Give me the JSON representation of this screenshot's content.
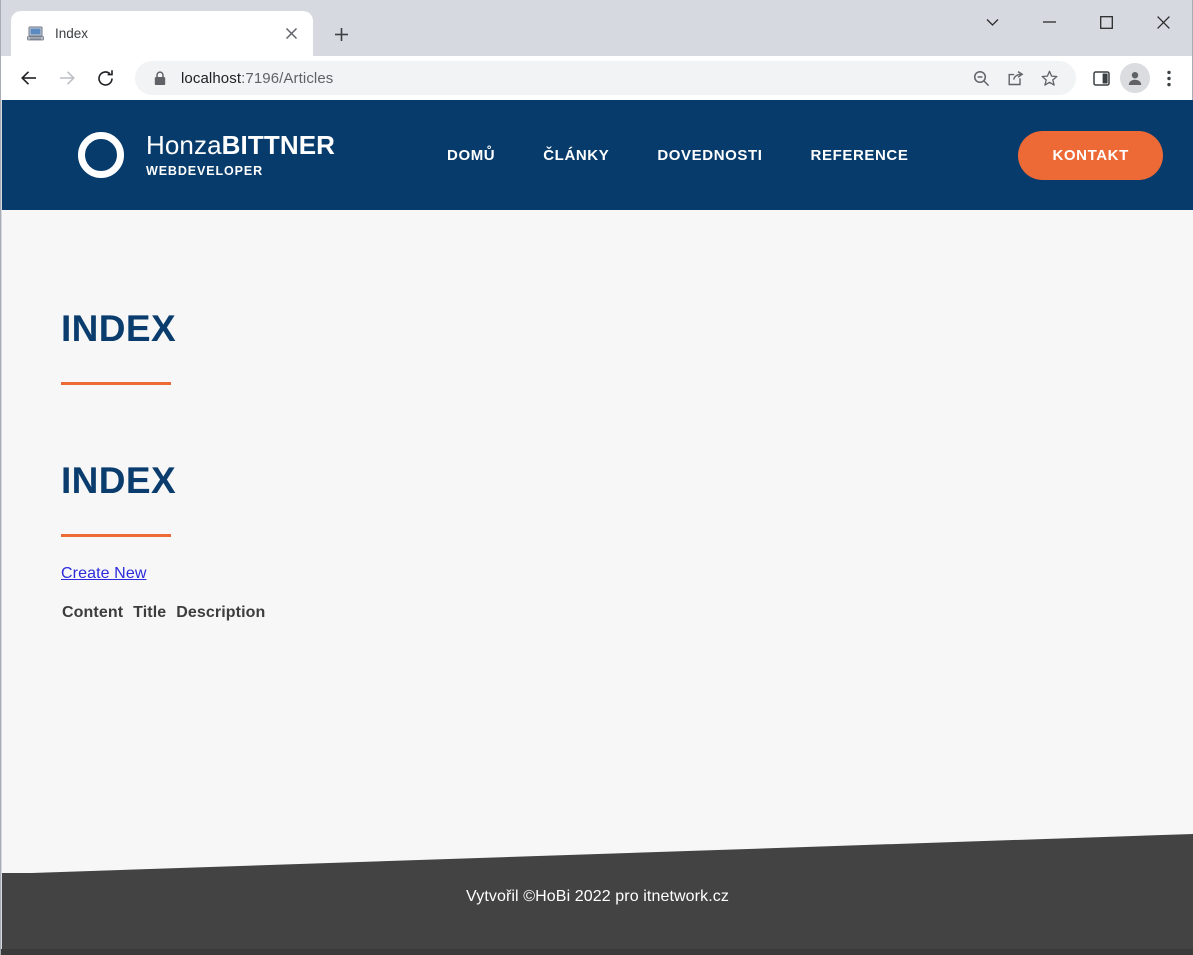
{
  "browser": {
    "tab": {
      "title": "Index",
      "favicon_icon": "computer-icon",
      "close_icon": "close-icon"
    },
    "new_tab_icon": "plus-icon",
    "window_controls": {
      "tab_search_icon": "chevron-down-icon",
      "minimize_icon": "minimize-icon",
      "maximize_icon": "maximize-icon",
      "close_icon": "close-icon"
    },
    "toolbar": {
      "back_icon": "arrow-left-icon",
      "forward_icon": "arrow-right-icon",
      "reload_icon": "reload-icon",
      "lock_icon": "lock-icon",
      "url_host": "localhost",
      "url_path": ":7196/Articles",
      "url_full": "localhost:7196/Articles",
      "zoom_out_icon": "zoom-out-icon",
      "share_icon": "share-icon",
      "bookmark_icon": "star-icon",
      "side_panel_icon": "side-panel-icon",
      "profile_icon": "person-icon",
      "menu_icon": "three-dots-icon"
    }
  },
  "site": {
    "colors": {
      "navy": "#073b6b",
      "orange": "#ed6a36",
      "heading_navy": "#0a3d6e",
      "footer_gray": "#434343",
      "page_bg": "#f7f7f7",
      "link_blue": "#2b2bdd"
    },
    "header": {
      "logo_icon": "ring-logo-icon",
      "brand_first": "Honza",
      "brand_second": "BITTNER",
      "brand_tagline": "WEBDEVELOPER",
      "nav": [
        {
          "label": "DOMŮ"
        },
        {
          "label": "ČLÁNKY"
        },
        {
          "label": "DOVEDNOSTI"
        },
        {
          "label": "REFERENCE"
        }
      ],
      "cta_label": "KONTAKT"
    },
    "main": {
      "page_heading": "INDEX",
      "section_heading": "INDEX",
      "create_link": "Create New",
      "table": {
        "columns": [
          "Content",
          "Title",
          "Description"
        ],
        "rows": []
      }
    },
    "footer": {
      "text": "Vytvořil ©HoBi 2022 pro itnetwork.cz"
    }
  }
}
